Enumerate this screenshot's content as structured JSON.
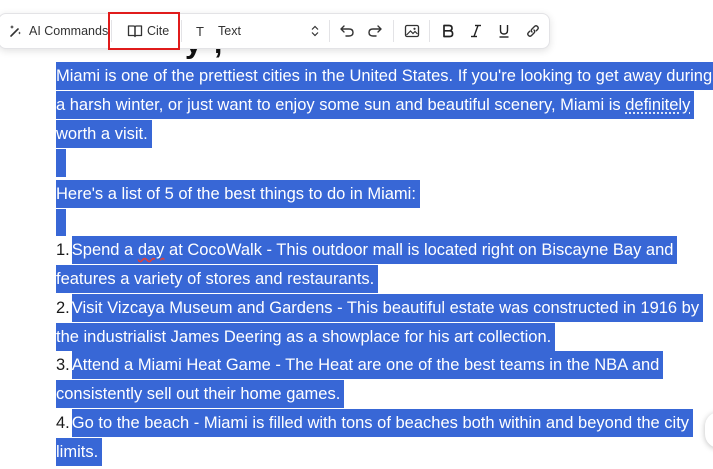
{
  "toolbar": {
    "ai_commands_label": "AI Commands",
    "cite_label": "Cite",
    "block_type_icon_char": "T",
    "block_type_value": "Text"
  },
  "editor": {
    "heading_peek": "y  ,",
    "paragraph1": [
      "Miami is one of the prettiest cities in the United States. If you're looking to get away during",
      "a harsh winter, or just want to enjoy some sun and beautiful scenery, Miami is ",
      "definitely",
      "worth a visit."
    ],
    "list_intro": "Here's a list of 5 of the best things to do in Miami:",
    "items": [
      {
        "num": "1.",
        "l1a": "Spend a ",
        "l1b": "day",
        "l1c": " at CocoWalk - This outdoor mall is located right on Biscayne Bay and",
        "l2": "features a variety of stores and restaurants."
      },
      {
        "num": "2.",
        "l1": "Visit Vizcaya Museum and Gardens - This beautiful estate was constructed in 1916 by",
        "l2": "the industrialist James Deering as a showplace for his art collection."
      },
      {
        "num": "3.",
        "l1": "Attend a Miami Heat Game - The Heat are one of the best teams in the NBA and",
        "l2": "consistently sell out their home games."
      },
      {
        "num": "4.",
        "l1": "Go to the beach - Miami is filled with tons of beaches both within and beyond the city",
        "l2": "limits."
      }
    ]
  },
  "colors": {
    "selection": "#3867d6",
    "highlight_box": "#e01b1b",
    "spellcheck": "#e0403a"
  }
}
